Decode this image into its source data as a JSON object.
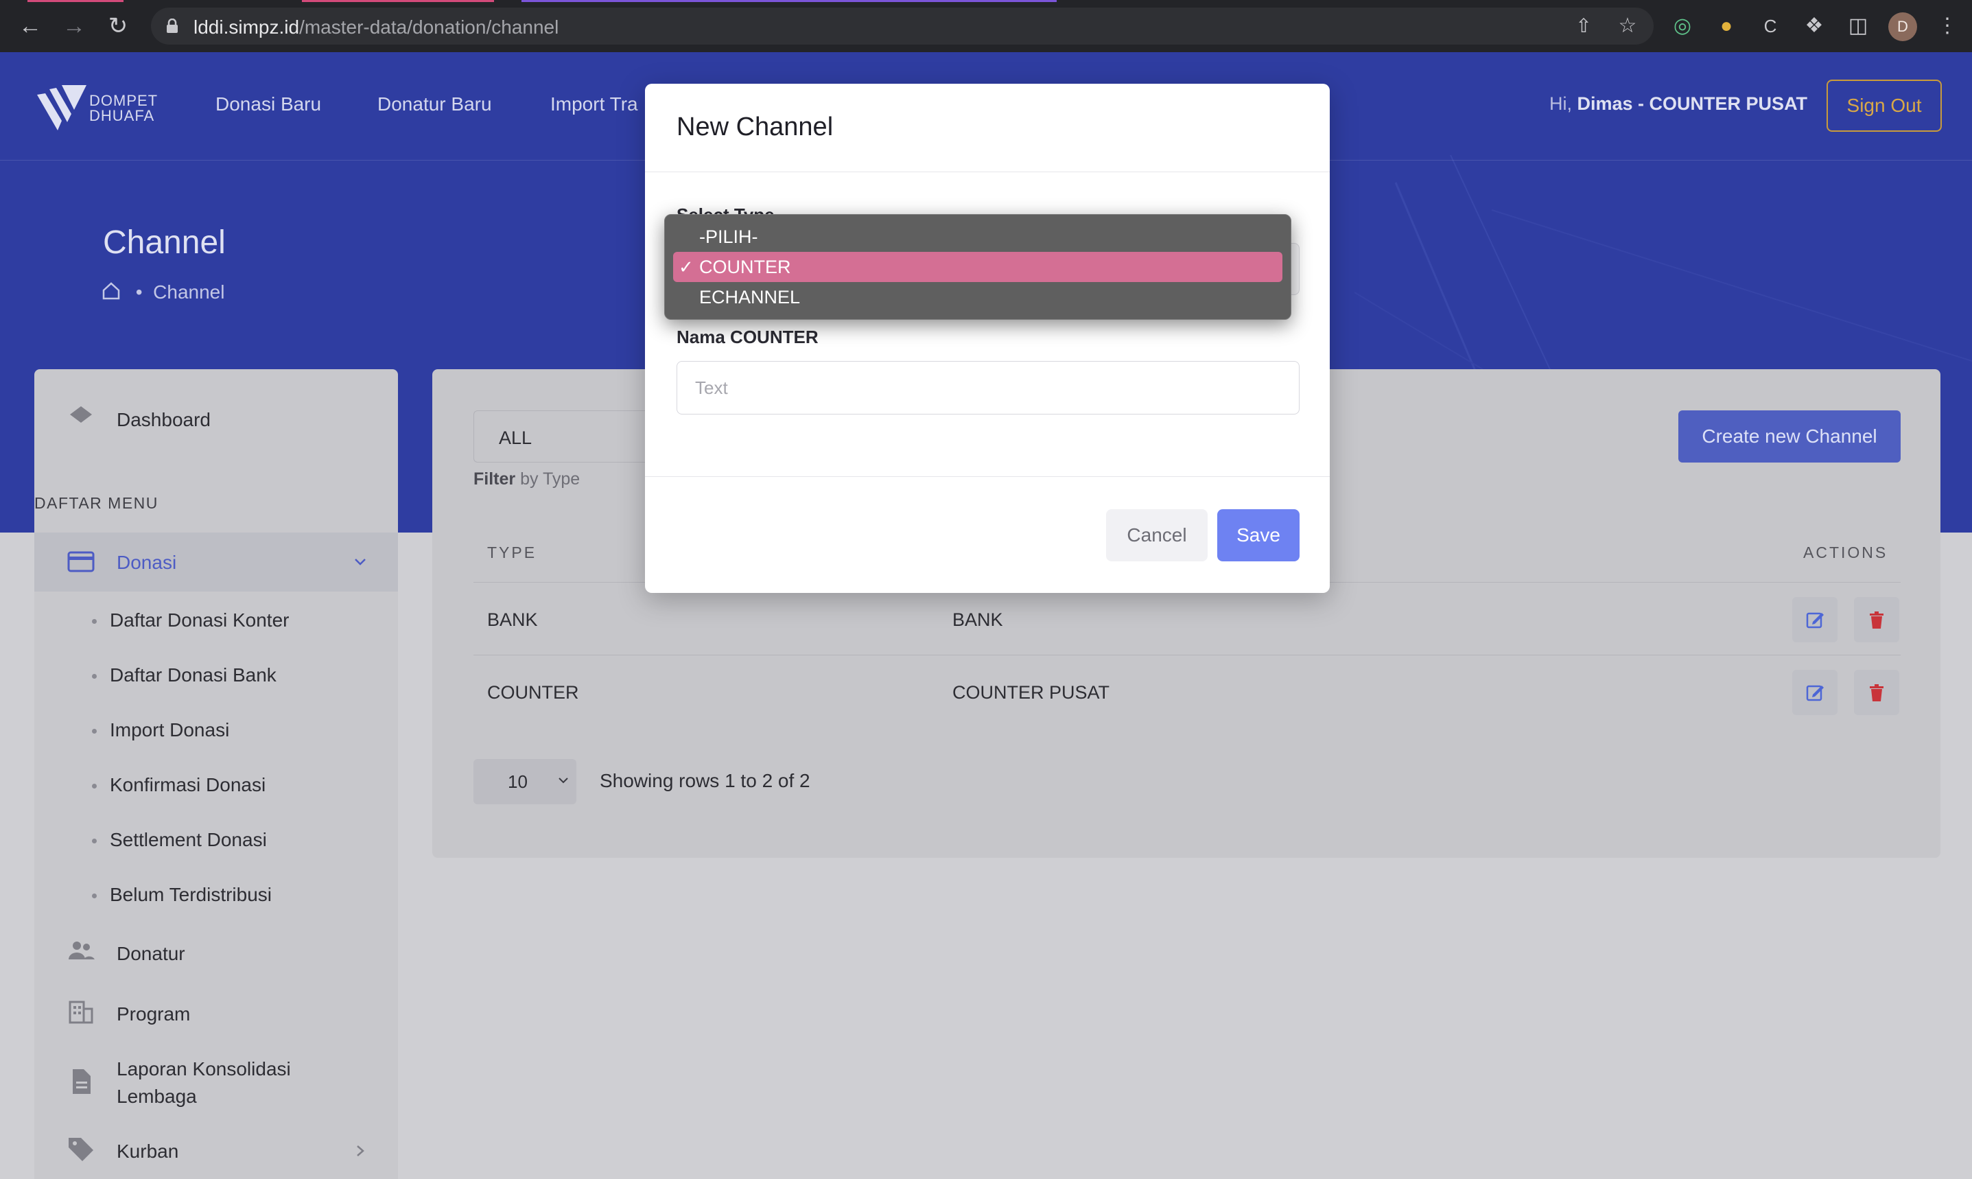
{
  "browser": {
    "url_host": "lddi.simpz.id",
    "url_path": "/master-data/donation/channel",
    "profile_initial": "D"
  },
  "header": {
    "logo_line1": "DOMPET",
    "logo_line2": "DHUAFA",
    "nav": [
      "Donasi Baru",
      "Donatur Baru",
      "Import Tra"
    ],
    "greeting_prefix": "Hi,",
    "greeting_user": "Dimas - COUNTER PUSAT",
    "sign_out": "Sign Out"
  },
  "page": {
    "title": "Channel",
    "breadcrumb": "Channel"
  },
  "sidebar": {
    "dashboard": "Dashboard",
    "section_label": "DAFTAR MENU",
    "donasi": "Donasi",
    "donasi_items": [
      "Daftar Donasi Konter",
      "Daftar Donasi Bank",
      "Import Donasi",
      "Konfirmasi Donasi",
      "Settlement Donasi",
      "Belum Terdistribusi"
    ],
    "donatur": "Donatur",
    "program": "Program",
    "laporan_line1": "Laporan Konsolidasi",
    "laporan_line2": "Lembaga",
    "kurban": "Kurban"
  },
  "main": {
    "filter_value": "ALL",
    "filter_hint_bold": "Filter",
    "filter_hint_rest": "by Type",
    "create_button": "Create new Channel",
    "columns": {
      "type": "TYPE",
      "actions": "ACTIONS"
    },
    "rows": [
      {
        "type": "BANK",
        "name": "BANK"
      },
      {
        "type": "COUNTER",
        "name": "COUNTER PUSAT"
      }
    ],
    "page_size": "10",
    "showing": "Showing rows 1 to 2 of 2"
  },
  "modal": {
    "title": "New Channel",
    "select_label": "Select Type",
    "options": [
      "-PILIH-",
      "COUNTER",
      "ECHANNEL"
    ],
    "selected_option": "COUNTER",
    "name_label": "Nama COUNTER",
    "name_placeholder": "Text",
    "cancel": "Cancel",
    "save": "Save"
  },
  "colors": {
    "hero": "#2f3da1",
    "primary_button": "#6e82f2",
    "sign_out": "#c99b3b",
    "selected_option": "#d46f94",
    "delete_icon": "#c9343a",
    "edit_icon": "#4d66d6"
  }
}
